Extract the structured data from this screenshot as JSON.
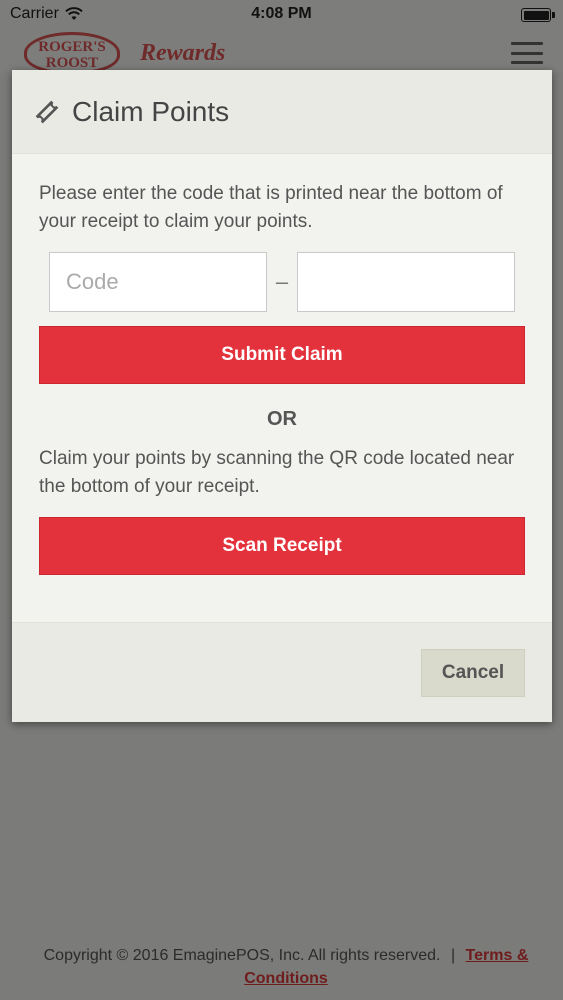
{
  "status_bar": {
    "carrier": "Carrier",
    "time": "4:08 PM"
  },
  "app_header": {
    "logo_text_line1": "ROGER'S",
    "logo_text_line2": "ROOST",
    "rewards": "Rewards",
    "menu_icon": "hamburger-menu-icon"
  },
  "modal": {
    "title": "Claim Points",
    "title_icon": "ticket-icon",
    "instructions": "Please enter the code that is printed near the bottom of your receipt to claim your points.",
    "code_input_1": {
      "placeholder": "Code",
      "value": ""
    },
    "code_separator": "–",
    "code_input_2": {
      "placeholder": "",
      "value": ""
    },
    "submit_label": "Submit Claim",
    "or_label": "OR",
    "qr_instructions": "Claim your points by scanning the QR code located near the bottom of your receipt.",
    "scan_label": "Scan Receipt",
    "cancel_label": "Cancel"
  },
  "footer": {
    "copyright": "Copyright © 2016  EmaginePOS, Inc.  All rights reserved.",
    "separator": "|",
    "terms_link": "Terms & Conditions"
  },
  "colors": {
    "primary_red": "#e3323b",
    "modal_bg": "#f2f2ef",
    "overlay": "#7b7b79",
    "brand_dark_red": "#6f2a2a",
    "cancel_bg": "#d9d9cc"
  }
}
